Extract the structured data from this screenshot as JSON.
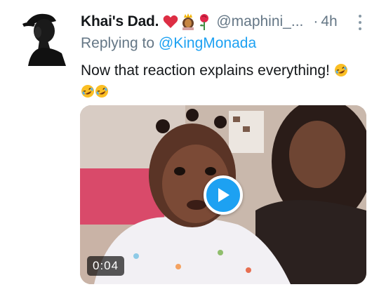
{
  "tweet": {
    "display_name": "Khai's Dad.",
    "name_emojis": [
      "red-heart",
      "princess",
      "rose"
    ],
    "handle": "@maphini_...",
    "dot": "·",
    "time": "4h",
    "replying_prefix": "Replying to",
    "replying_to": "@KingMonada",
    "text": "Now that reaction explains everything!",
    "text_emojis": [
      "rolling-on-floor-laughing",
      "rolling-on-floor-laughing",
      "rolling-on-floor-laughing"
    ]
  },
  "video": {
    "duration": "0:04",
    "play_icon": "play-icon"
  },
  "colors": {
    "link": "#1da1f2",
    "secondary_text": "#657786",
    "play_button": "#1da1f2"
  }
}
